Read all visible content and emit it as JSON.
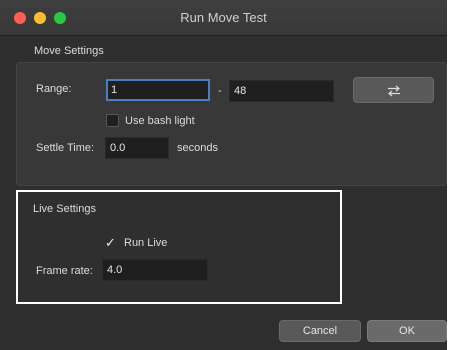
{
  "window": {
    "title": "Run Move Test"
  },
  "move_settings": {
    "label": "Move Settings",
    "range_label": "Range:",
    "range_start": "1",
    "range_separator": "-",
    "range_end": "48",
    "swap_icon": "swap-arrows-icon",
    "use_bash_light_label": "Use bash light",
    "settle_time_label": "Settle Time:",
    "settle_time_value": "0.0",
    "settle_time_unit": "seconds"
  },
  "live_settings": {
    "label": "Live Settings",
    "run_live_label": "Run Live",
    "run_live_checked": true,
    "frame_rate_label": "Frame rate:",
    "frame_rate_value": "4.0"
  },
  "buttons": {
    "cancel": "Cancel",
    "ok": "OK"
  }
}
